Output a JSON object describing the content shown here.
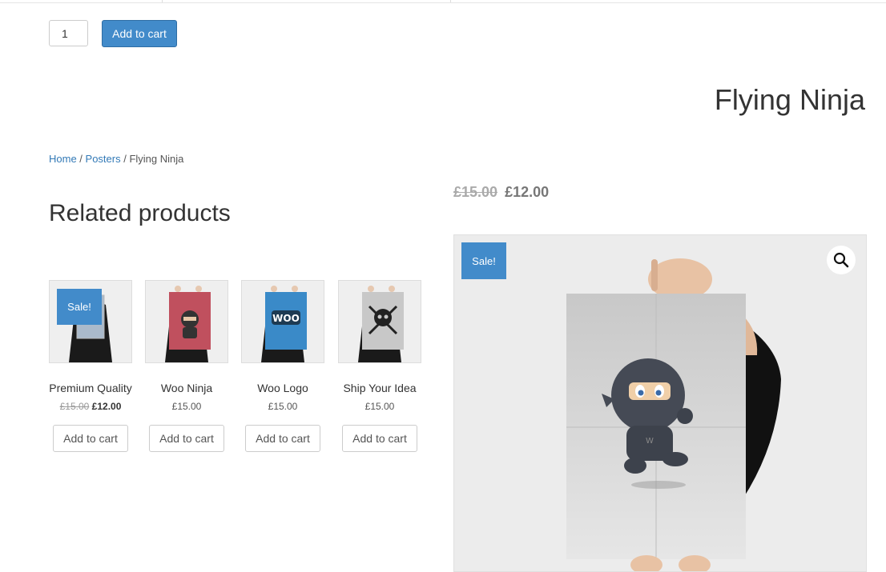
{
  "cart_form": {
    "quantity": "1",
    "add_to_cart_label": "Add to cart"
  },
  "product": {
    "title": "Flying Ninja",
    "price_old": "£15.00",
    "price_new": "£12.00",
    "sale_badge": "Sale!"
  },
  "breadcrumb": {
    "home": "Home",
    "sep1": " / ",
    "category": "Posters",
    "sep2": " / ",
    "current": "Flying Ninja"
  },
  "related": {
    "heading": "Related products",
    "items": [
      {
        "name": "Premium Quality",
        "price_old": "£15.00",
        "price_new": "£12.00",
        "sale": "Sale!",
        "button": "Add to cart",
        "poster_color": "#a8b8c8"
      },
      {
        "name": "Woo Ninja",
        "price": "£15.00",
        "button": "Add to cart",
        "poster_color": "#c0505e"
      },
      {
        "name": "Woo Logo",
        "price": "£15.00",
        "button": "Add to cart",
        "poster_color": "#3a8ac8"
      },
      {
        "name": "Ship Your Idea",
        "price": "£15.00",
        "button": "Add to cart",
        "poster_color": "#c8c8c8"
      }
    ]
  },
  "icons": {
    "zoom": "magnifier-icon"
  }
}
